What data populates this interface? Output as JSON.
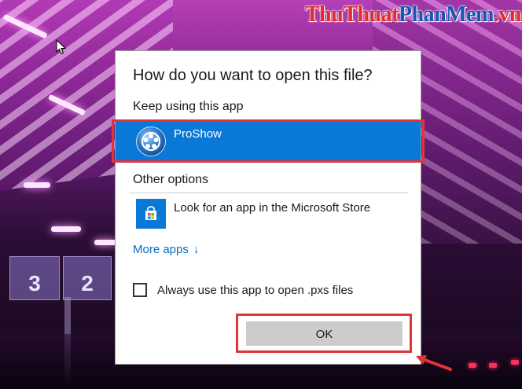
{
  "watermark": {
    "part1": "ThuThuat",
    "part2": "PhanMem",
    "part3": ".vn"
  },
  "dialog": {
    "title": "How do you want to open this file?",
    "keep_section_label": "Keep using this app",
    "selected_app": {
      "name": "ProShow",
      "icon": "proshow-icon"
    },
    "other_section_label": "Other options",
    "store_option": {
      "label": "Look for an app in the Microsoft Store",
      "icon": "microsoft-store-icon"
    },
    "more_apps_label": "More apps",
    "more_apps_arrow": "↓",
    "always_use_label": "Always use this app to open .pxs files",
    "always_use_checked": false,
    "ok_label": "OK"
  },
  "background": {
    "sign_numbers": [
      "3",
      "2"
    ]
  },
  "colors": {
    "accent": "#0a78d7",
    "highlight": "#e0333a",
    "link": "#0a6cc8",
    "button": "#cccccc"
  }
}
